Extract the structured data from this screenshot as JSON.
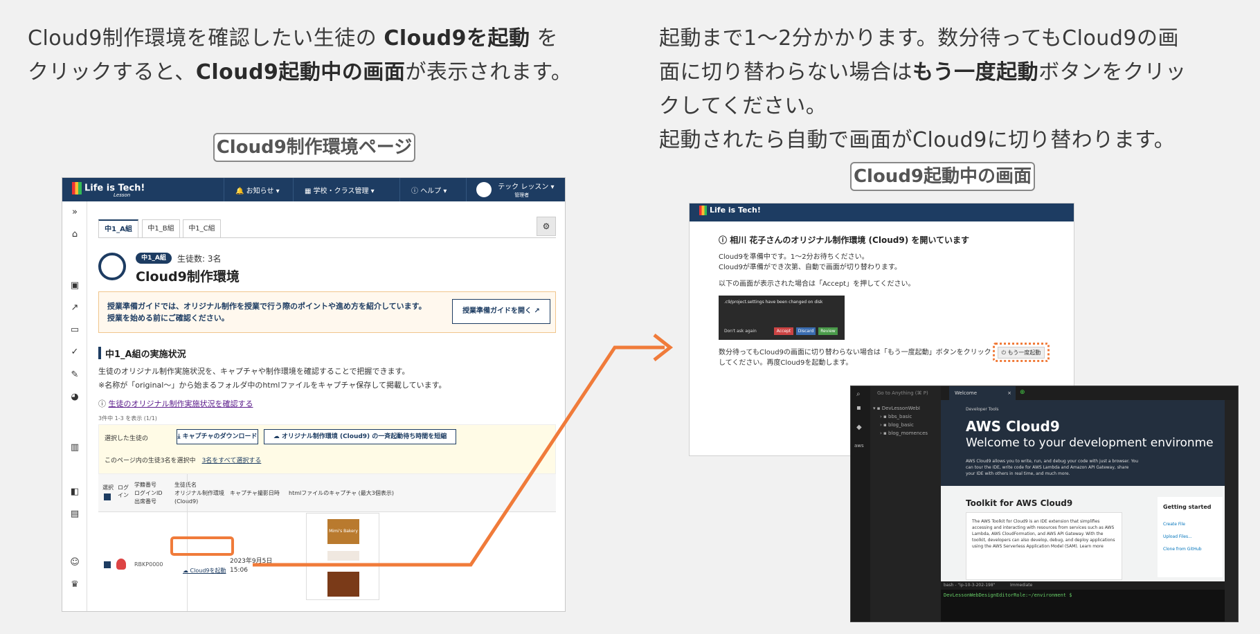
{
  "caption_left": {
    "line1_pre": "Cloud9制作環境を確認したい生徒の ",
    "line1_bold": "Cloud9を起動",
    "line1_post": " を",
    "line2_pre": "クリックすると、",
    "line2_bold": "Cloud9起動中の画面",
    "line2_post": "が表示されます。"
  },
  "caption_right": {
    "line1": "起動まで1〜2分かかります。数分待ってもCloud9の画",
    "line2_pre": "面に切り替わらない場合は",
    "line2_bold": "もう一度起動",
    "line2_post": "ボタンをクリッ",
    "line3": "クしてください。",
    "line4": "起動されたら自動で画面がCloud9に切り替わります。"
  },
  "label_left": "Cloud9制作環境ページ",
  "label_right": "Cloud9起動中の画面",
  "left_screen": {
    "logo": "Life is Tech!",
    "logo_sub": "Lesson",
    "nav": {
      "news": "お知らせ",
      "school": "学校・クラス管理",
      "help": "ヘルプ",
      "user": "テック レッスン",
      "user_role": "管理者"
    },
    "tabs": [
      "中1_A組",
      "中1_B組",
      "中1_C組"
    ],
    "class_badge": "中1_A組",
    "student_count": "生徒数: 3名",
    "page_title": "Cloud9制作環境",
    "guide_text1": "授業準備ガイドでは、オリジナル制作を授業で行う際のポイントや進め方を紹介しています。",
    "guide_text2": "授業を始める前にご確認ください。",
    "guide_button": "授業準備ガイドを開く",
    "section_title": "中1_A組の実施状況",
    "desc1": "生徒のオリジナル制作実施状況を、キャプチャや制作環境を確認することで把握できます。",
    "desc2": "※名称が「original〜」から始まるフォルダ中のhtmlファイルをキャプチャ保存して掲載しています。",
    "help_link": "生徒のオリジナル制作実施状況を確認する",
    "paging": "3件中 1-3 を表示 (1/1)",
    "selected_label": "選択した生徒の",
    "download_btn": "キャプチャのダウンロード",
    "extend_btn": "オリジナル制作環境 (Cloud9) の一斉起動待ち時間を短縮",
    "select_msg": "このページ内の生徒3名を選択中",
    "select_all": "3名をすべて選択する",
    "th": {
      "select": "選択",
      "login": "ログイン",
      "ids": "学籍番号\nログインID\n出席番号",
      "name": "生徒氏名\nオリジナル制作環境\n(Cloud9)",
      "date": "キャプチャ撮影日時",
      "capture": "htmlファイルのキャプチャ (最大3個表示)"
    },
    "row": {
      "id": "RBKP0000",
      "launch": "Cloud9を起動",
      "date": "2023年9月5日",
      "time": "15:06"
    },
    "thumb_title": "Mimi's Bakery"
  },
  "right_screen": {
    "logo": "Life is Tech!",
    "heading": "相川 花子さんのオリジナル制作環境 (Cloud9) を開いています",
    "p1": "Cloud9を準備中です。1〜2分お待ちください。",
    "p2": "Cloud9が準備ができ次第、自動で画面が切り替わります。",
    "p3": "以下の画面が表示された場合は「Accept」を押してください。",
    "dialog_title": ".c9/project.settings have been changed on disk",
    "dialog_buttons": [
      "Accept",
      "Discard",
      "Review"
    ],
    "dialog_check": "Don't ask again",
    "p4": "数分待ってもCloud9の画面に切り替わらない場合は「もう一度起動」ボタンをクリック",
    "p5": "してください。再度Cloud9を起動します。",
    "relaunch": "もう一度起動"
  },
  "aws_screen": {
    "search": "Go to Anything (⌘ P)",
    "tab": "Welcome",
    "folders": [
      "DevLessonWebI",
      "bbs_basic",
      "blog_basic",
      "blog_momences"
    ],
    "dev_tools": "Developer Tools",
    "title": "AWS Cloud9",
    "subtitle": "Welcome to your development environme",
    "intro": "AWS Cloud9 allows you to write, run, and debug your code with just a browser. You can tour the IDE, write code for AWS Lambda and Amazon API Gateway, share your IDE with others in real time, and much more.",
    "toolkit": "Toolkit for AWS Cloud9",
    "toolkit_text": "The AWS Toolkit for Cloud9 is an IDE extension that simplifies accessing and interacting with resources from services such as AWS Lambda, AWS CloudFormation, and AWS API Gateway. With the toolkit, developers can also develop, debug, and deploy applications using the AWS Serverless Application Model (SAM). Learn more",
    "getting_started": "Getting started",
    "gs_links": [
      "Create File",
      "Upload Files...",
      "Clone from GitHub"
    ],
    "term_tabs": [
      "bash - \"ip-10-3-202-198\"",
      "Immediate"
    ],
    "prompt": "DevLessonWebDesignEditorRole:~/environment $"
  }
}
